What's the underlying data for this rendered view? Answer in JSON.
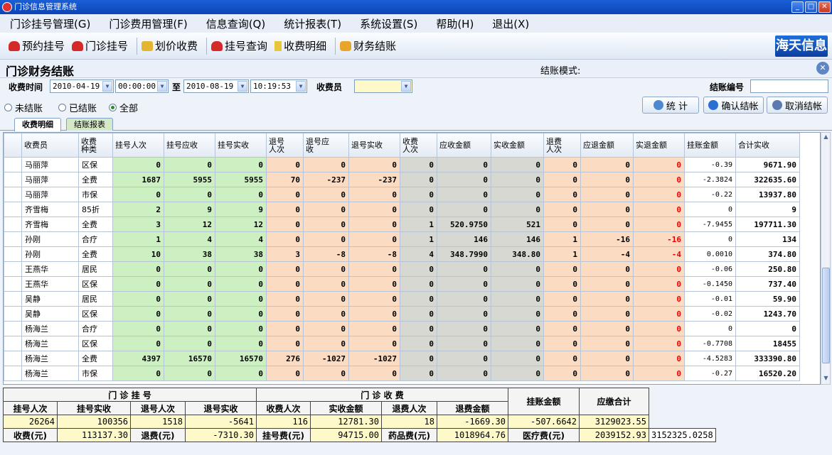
{
  "window": {
    "title": "门诊信息管理系统"
  },
  "menu": [
    "门诊挂号管理(G)",
    "门诊费用管理(F)",
    "信息查询(Q)",
    "统计报表(T)",
    "系统设置(S)",
    "帮助(H)",
    "退出(X)"
  ],
  "toolbar": [
    "预约挂号",
    "门诊挂号",
    "划价收费",
    "挂号查询",
    "收费明细",
    "财务结账"
  ],
  "logo": "海天信息",
  "panel": {
    "title": "门诊财务结账",
    "mode": "结账模式:"
  },
  "filter": {
    "time_label": "收费时间",
    "date_from": "2010-04-19",
    "time_from": "00:00:00",
    "to_label": "至",
    "date_to": "2010-08-19",
    "time_to": "10:19:53",
    "cashier_label": "收费员",
    "settle_no_label": "结账编号"
  },
  "radios": [
    {
      "label": "未结账",
      "checked": false
    },
    {
      "label": "已结账",
      "checked": false
    },
    {
      "label": "全部",
      "checked": true
    }
  ],
  "buttons": {
    "stat": "统 计",
    "confirm": "确认结帐",
    "cancel": "取消结帐"
  },
  "tabs": [
    "收费明细",
    "结账报表"
  ],
  "grid": {
    "columns": [
      "收费员",
      "收费\n种类",
      "挂号人次",
      "挂号应收",
      "挂号实收",
      "退号\n人次",
      "退号应\n收",
      "退号实收",
      "收费\n人次",
      "应收金额",
      "实收金额",
      "退费\n人次",
      "应退金额",
      "实退金额",
      "挂账金额",
      "合计实收"
    ],
    "rows": [
      [
        "马丽萍",
        "区保",
        "0",
        "0",
        "0",
        "0",
        "0",
        "0",
        "0",
        "0",
        "0",
        "0",
        "0",
        "0",
        "-0.39",
        "9671.90"
      ],
      [
        "马丽萍",
        "全费",
        "1687",
        "5955",
        "5955",
        "70",
        "-237",
        "-237",
        "0",
        "0",
        "0",
        "0",
        "0",
        "0",
        "-2.3824",
        "322635.60"
      ],
      [
        "马丽萍",
        "市保",
        "0",
        "0",
        "0",
        "0",
        "0",
        "0",
        "0",
        "0",
        "0",
        "0",
        "0",
        "0",
        "-0.22",
        "13937.80"
      ],
      [
        "齐雪梅",
        "85折",
        "2",
        "9",
        "9",
        "0",
        "0",
        "0",
        "0",
        "0",
        "0",
        "0",
        "0",
        "0",
        "0",
        "9"
      ],
      [
        "齐雪梅",
        "全费",
        "3",
        "12",
        "12",
        "0",
        "0",
        "0",
        "1",
        "520.9750",
        "521",
        "0",
        "0",
        "0",
        "-7.9455",
        "197711.30"
      ],
      [
        "孙刚",
        "合疗",
        "1",
        "4",
        "4",
        "0",
        "0",
        "0",
        "1",
        "146",
        "146",
        "1",
        "-16",
        "-16",
        "0",
        "134"
      ],
      [
        "孙刚",
        "全费",
        "10",
        "38",
        "38",
        "3",
        "-8",
        "-8",
        "4",
        "348.7990",
        "348.80",
        "1",
        "-4",
        "-4",
        "0.0010",
        "374.80"
      ],
      [
        "王燕华",
        "居民",
        "0",
        "0",
        "0",
        "0",
        "0",
        "0",
        "0",
        "0",
        "0",
        "0",
        "0",
        "0",
        "-0.06",
        "250.80"
      ],
      [
        "王燕华",
        "区保",
        "0",
        "0",
        "0",
        "0",
        "0",
        "0",
        "0",
        "0",
        "0",
        "0",
        "0",
        "0",
        "-0.1450",
        "737.40"
      ],
      [
        "吴静",
        "居民",
        "0",
        "0",
        "0",
        "0",
        "0",
        "0",
        "0",
        "0",
        "0",
        "0",
        "0",
        "0",
        "-0.01",
        "59.90"
      ],
      [
        "吴静",
        "区保",
        "0",
        "0",
        "0",
        "0",
        "0",
        "0",
        "0",
        "0",
        "0",
        "0",
        "0",
        "0",
        "-0.02",
        "1243.70"
      ],
      [
        "杨海兰",
        "合疗",
        "0",
        "0",
        "0",
        "0",
        "0",
        "0",
        "0",
        "0",
        "0",
        "0",
        "0",
        "0",
        "0",
        "0"
      ],
      [
        "杨海兰",
        "区保",
        "0",
        "0",
        "0",
        "0",
        "0",
        "0",
        "0",
        "0",
        "0",
        "0",
        "0",
        "0",
        "-0.7708",
        "18455"
      ],
      [
        "杨海兰",
        "全费",
        "4397",
        "16570",
        "16570",
        "276",
        "-1027",
        "-1027",
        "0",
        "0",
        "0",
        "0",
        "0",
        "0",
        "-4.5283",
        "333390.80"
      ],
      [
        "杨海兰",
        "市保",
        "0",
        "0",
        "0",
        "0",
        "0",
        "0",
        "0",
        "0",
        "0",
        "0",
        "0",
        "0",
        "-0.27",
        "16520.20"
      ]
    ]
  },
  "summary": {
    "group1": "门    诊    挂    号",
    "group2": "门    诊    收    费",
    "h": [
      "挂号人次",
      "挂号实收",
      "退号人次",
      "退号实收",
      "收费人次",
      "实收金额",
      "退费人次",
      "退费金额",
      "挂账金额",
      "应缴合计"
    ],
    "v": [
      "26264",
      "100356",
      "1518",
      "-5641",
      "116",
      "12781.30",
      "18",
      "-1669.30",
      "-507.6642",
      "3129023.55"
    ],
    "l": [
      "收费(元)",
      "退费(元)",
      "挂号费(元)",
      "药品费(元)",
      "医疗费(元)"
    ],
    "lv": [
      "113137.30",
      "-7310.30",
      "94715.00",
      "1018964.76",
      "2039152.93",
      "3152325.0258"
    ]
  },
  "colors": {
    "green": "#cdf0c2",
    "orange": "#fbdcc2",
    "gray": "#d8d8d2",
    "negative": "#e00000"
  }
}
